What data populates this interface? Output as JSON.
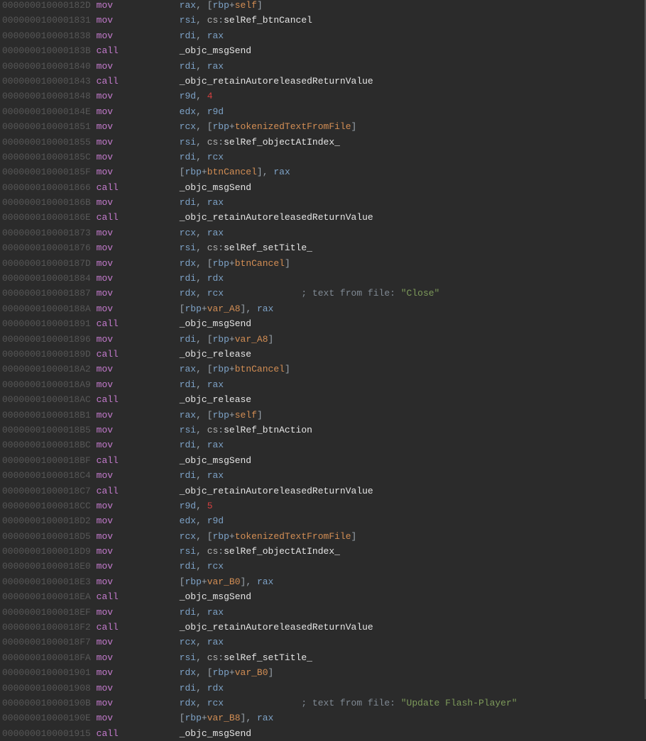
{
  "rows": [
    {
      "addr": "000000010000182D",
      "mn": "mov",
      "ops": [
        {
          "t": "reg",
          "v": "rax"
        },
        {
          "t": "punc",
          "v": ", "
        },
        {
          "t": "brkt",
          "v": "["
        },
        {
          "t": "reg",
          "v": "rbp"
        },
        {
          "t": "punc",
          "v": "+"
        },
        {
          "t": "kw",
          "v": "self"
        },
        {
          "t": "brkt",
          "v": "]"
        }
      ]
    },
    {
      "addr": "0000000100001831",
      "mn": "mov",
      "ops": [
        {
          "t": "reg",
          "v": "rsi"
        },
        {
          "t": "punc",
          "v": ", "
        },
        {
          "t": "seg",
          "v": "cs"
        },
        {
          "t": "punc",
          "v": ":"
        },
        {
          "t": "sym",
          "v": "selRef_btnCancel"
        }
      ]
    },
    {
      "addr": "0000000100001838",
      "mn": "mov",
      "ops": [
        {
          "t": "reg",
          "v": "rdi"
        },
        {
          "t": "punc",
          "v": ", "
        },
        {
          "t": "reg",
          "v": "rax"
        }
      ]
    },
    {
      "addr": "000000010000183B",
      "mn": "call",
      "ops": [
        {
          "t": "sym",
          "v": "_objc_msgSend"
        }
      ]
    },
    {
      "addr": "0000000100001840",
      "mn": "mov",
      "ops": [
        {
          "t": "reg",
          "v": "rdi"
        },
        {
          "t": "punc",
          "v": ", "
        },
        {
          "t": "reg",
          "v": "rax"
        }
      ]
    },
    {
      "addr": "0000000100001843",
      "mn": "call",
      "ops": [
        {
          "t": "sym",
          "v": "_objc_retainAutoreleasedReturnValue"
        }
      ]
    },
    {
      "addr": "0000000100001848",
      "mn": "mov",
      "ops": [
        {
          "t": "reg",
          "v": "r9d"
        },
        {
          "t": "punc",
          "v": ", "
        },
        {
          "t": "num",
          "v": "4"
        }
      ]
    },
    {
      "addr": "000000010000184E",
      "mn": "mov",
      "ops": [
        {
          "t": "reg",
          "v": "edx"
        },
        {
          "t": "punc",
          "v": ", "
        },
        {
          "t": "reg",
          "v": "r9d"
        }
      ]
    },
    {
      "addr": "0000000100001851",
      "mn": "mov",
      "ops": [
        {
          "t": "reg",
          "v": "rcx"
        },
        {
          "t": "punc",
          "v": ", "
        },
        {
          "t": "brkt",
          "v": "["
        },
        {
          "t": "reg",
          "v": "rbp"
        },
        {
          "t": "punc",
          "v": "+"
        },
        {
          "t": "kw",
          "v": "tokenizedTextFromFile"
        },
        {
          "t": "brkt",
          "v": "]"
        }
      ]
    },
    {
      "addr": "0000000100001855",
      "mn": "mov",
      "ops": [
        {
          "t": "reg",
          "v": "rsi"
        },
        {
          "t": "punc",
          "v": ", "
        },
        {
          "t": "seg",
          "v": "cs"
        },
        {
          "t": "punc",
          "v": ":"
        },
        {
          "t": "sym",
          "v": "selRef_objectAtIndex_"
        }
      ]
    },
    {
      "addr": "000000010000185C",
      "mn": "mov",
      "ops": [
        {
          "t": "reg",
          "v": "rdi"
        },
        {
          "t": "punc",
          "v": ", "
        },
        {
          "t": "reg",
          "v": "rcx"
        }
      ]
    },
    {
      "addr": "000000010000185F",
      "mn": "mov",
      "ops": [
        {
          "t": "brkt",
          "v": "["
        },
        {
          "t": "reg",
          "v": "rbp"
        },
        {
          "t": "punc",
          "v": "+"
        },
        {
          "t": "kw",
          "v": "btnCancel"
        },
        {
          "t": "brkt",
          "v": "]"
        },
        {
          "t": "punc",
          "v": ", "
        },
        {
          "t": "reg",
          "v": "rax"
        }
      ]
    },
    {
      "addr": "0000000100001866",
      "mn": "call",
      "ops": [
        {
          "t": "sym",
          "v": "_objc_msgSend"
        }
      ]
    },
    {
      "addr": "000000010000186B",
      "mn": "mov",
      "ops": [
        {
          "t": "reg",
          "v": "rdi"
        },
        {
          "t": "punc",
          "v": ", "
        },
        {
          "t": "reg",
          "v": "rax"
        }
      ]
    },
    {
      "addr": "000000010000186E",
      "mn": "call",
      "ops": [
        {
          "t": "sym",
          "v": "_objc_retainAutoreleasedReturnValue"
        }
      ]
    },
    {
      "addr": "0000000100001873",
      "mn": "mov",
      "ops": [
        {
          "t": "reg",
          "v": "rcx"
        },
        {
          "t": "punc",
          "v": ", "
        },
        {
          "t": "reg",
          "v": "rax"
        }
      ]
    },
    {
      "addr": "0000000100001876",
      "mn": "mov",
      "ops": [
        {
          "t": "reg",
          "v": "rsi"
        },
        {
          "t": "punc",
          "v": ", "
        },
        {
          "t": "seg",
          "v": "cs"
        },
        {
          "t": "punc",
          "v": ":"
        },
        {
          "t": "sym",
          "v": "selRef_setTitle_"
        }
      ]
    },
    {
      "addr": "000000010000187D",
      "mn": "mov",
      "ops": [
        {
          "t": "reg",
          "v": "rdx"
        },
        {
          "t": "punc",
          "v": ", "
        },
        {
          "t": "brkt",
          "v": "["
        },
        {
          "t": "reg",
          "v": "rbp"
        },
        {
          "t": "punc",
          "v": "+"
        },
        {
          "t": "kw",
          "v": "btnCancel"
        },
        {
          "t": "brkt",
          "v": "]"
        }
      ]
    },
    {
      "addr": "0000000100001884",
      "mn": "mov",
      "ops": [
        {
          "t": "reg",
          "v": "rdi"
        },
        {
          "t": "punc",
          "v": ", "
        },
        {
          "t": "reg",
          "v": "rdx"
        }
      ]
    },
    {
      "addr": "0000000100001887",
      "mn": "mov",
      "ops": [
        {
          "t": "reg",
          "v": "rdx"
        },
        {
          "t": "punc",
          "v": ", "
        },
        {
          "t": "reg",
          "v": "rcx"
        }
      ],
      "cmt": "; text from file: \"Close\""
    },
    {
      "addr": "000000010000188A",
      "mn": "mov",
      "ops": [
        {
          "t": "brkt",
          "v": "["
        },
        {
          "t": "reg",
          "v": "rbp"
        },
        {
          "t": "punc",
          "v": "+"
        },
        {
          "t": "kw",
          "v": "var_A8"
        },
        {
          "t": "brkt",
          "v": "]"
        },
        {
          "t": "punc",
          "v": ", "
        },
        {
          "t": "reg",
          "v": "rax"
        }
      ]
    },
    {
      "addr": "0000000100001891",
      "mn": "call",
      "ops": [
        {
          "t": "sym",
          "v": "_objc_msgSend"
        }
      ]
    },
    {
      "addr": "0000000100001896",
      "mn": "mov",
      "ops": [
        {
          "t": "reg",
          "v": "rdi"
        },
        {
          "t": "punc",
          "v": ", "
        },
        {
          "t": "brkt",
          "v": "["
        },
        {
          "t": "reg",
          "v": "rbp"
        },
        {
          "t": "punc",
          "v": "+"
        },
        {
          "t": "kw",
          "v": "var_A8"
        },
        {
          "t": "brkt",
          "v": "]"
        }
      ]
    },
    {
      "addr": "000000010000189D",
      "mn": "call",
      "ops": [
        {
          "t": "sym",
          "v": "_objc_release"
        }
      ]
    },
    {
      "addr": "00000001000018A2",
      "mn": "mov",
      "ops": [
        {
          "t": "reg",
          "v": "rax"
        },
        {
          "t": "punc",
          "v": ", "
        },
        {
          "t": "brkt",
          "v": "["
        },
        {
          "t": "reg",
          "v": "rbp"
        },
        {
          "t": "punc",
          "v": "+"
        },
        {
          "t": "kw",
          "v": "btnCancel"
        },
        {
          "t": "brkt",
          "v": "]"
        }
      ]
    },
    {
      "addr": "00000001000018A9",
      "mn": "mov",
      "ops": [
        {
          "t": "reg",
          "v": "rdi"
        },
        {
          "t": "punc",
          "v": ", "
        },
        {
          "t": "reg",
          "v": "rax"
        }
      ]
    },
    {
      "addr": "00000001000018AC",
      "mn": "call",
      "ops": [
        {
          "t": "sym",
          "v": "_objc_release"
        }
      ]
    },
    {
      "addr": "00000001000018B1",
      "mn": "mov",
      "ops": [
        {
          "t": "reg",
          "v": "rax"
        },
        {
          "t": "punc",
          "v": ", "
        },
        {
          "t": "brkt",
          "v": "["
        },
        {
          "t": "reg",
          "v": "rbp"
        },
        {
          "t": "punc",
          "v": "+"
        },
        {
          "t": "kw",
          "v": "self"
        },
        {
          "t": "brkt",
          "v": "]"
        }
      ]
    },
    {
      "addr": "00000001000018B5",
      "mn": "mov",
      "ops": [
        {
          "t": "reg",
          "v": "rsi"
        },
        {
          "t": "punc",
          "v": ", "
        },
        {
          "t": "seg",
          "v": "cs"
        },
        {
          "t": "punc",
          "v": ":"
        },
        {
          "t": "sym",
          "v": "selRef_btnAction"
        }
      ]
    },
    {
      "addr": "00000001000018BC",
      "mn": "mov",
      "ops": [
        {
          "t": "reg",
          "v": "rdi"
        },
        {
          "t": "punc",
          "v": ", "
        },
        {
          "t": "reg",
          "v": "rax"
        }
      ]
    },
    {
      "addr": "00000001000018BF",
      "mn": "call",
      "ops": [
        {
          "t": "sym",
          "v": "_objc_msgSend"
        }
      ]
    },
    {
      "addr": "00000001000018C4",
      "mn": "mov",
      "ops": [
        {
          "t": "reg",
          "v": "rdi"
        },
        {
          "t": "punc",
          "v": ", "
        },
        {
          "t": "reg",
          "v": "rax"
        }
      ]
    },
    {
      "addr": "00000001000018C7",
      "mn": "call",
      "ops": [
        {
          "t": "sym",
          "v": "_objc_retainAutoreleasedReturnValue"
        }
      ]
    },
    {
      "addr": "00000001000018CC",
      "mn": "mov",
      "ops": [
        {
          "t": "reg",
          "v": "r9d"
        },
        {
          "t": "punc",
          "v": ", "
        },
        {
          "t": "num",
          "v": "5"
        }
      ]
    },
    {
      "addr": "00000001000018D2",
      "mn": "mov",
      "ops": [
        {
          "t": "reg",
          "v": "edx"
        },
        {
          "t": "punc",
          "v": ", "
        },
        {
          "t": "reg",
          "v": "r9d"
        }
      ]
    },
    {
      "addr": "00000001000018D5",
      "mn": "mov",
      "ops": [
        {
          "t": "reg",
          "v": "rcx"
        },
        {
          "t": "punc",
          "v": ", "
        },
        {
          "t": "brkt",
          "v": "["
        },
        {
          "t": "reg",
          "v": "rbp"
        },
        {
          "t": "punc",
          "v": "+"
        },
        {
          "t": "kw",
          "v": "tokenizedTextFromFile"
        },
        {
          "t": "brkt",
          "v": "]"
        }
      ]
    },
    {
      "addr": "00000001000018D9",
      "mn": "mov",
      "ops": [
        {
          "t": "reg",
          "v": "rsi"
        },
        {
          "t": "punc",
          "v": ", "
        },
        {
          "t": "seg",
          "v": "cs"
        },
        {
          "t": "punc",
          "v": ":"
        },
        {
          "t": "sym",
          "v": "selRef_objectAtIndex_"
        }
      ]
    },
    {
      "addr": "00000001000018E0",
      "mn": "mov",
      "ops": [
        {
          "t": "reg",
          "v": "rdi"
        },
        {
          "t": "punc",
          "v": ", "
        },
        {
          "t": "reg",
          "v": "rcx"
        }
      ]
    },
    {
      "addr": "00000001000018E3",
      "mn": "mov",
      "ops": [
        {
          "t": "brkt",
          "v": "["
        },
        {
          "t": "reg",
          "v": "rbp"
        },
        {
          "t": "punc",
          "v": "+"
        },
        {
          "t": "kw",
          "v": "var_B0"
        },
        {
          "t": "brkt",
          "v": "]"
        },
        {
          "t": "punc",
          "v": ", "
        },
        {
          "t": "reg",
          "v": "rax"
        }
      ]
    },
    {
      "addr": "00000001000018EA",
      "mn": "call",
      "ops": [
        {
          "t": "sym",
          "v": "_objc_msgSend"
        }
      ]
    },
    {
      "addr": "00000001000018EF",
      "mn": "mov",
      "ops": [
        {
          "t": "reg",
          "v": "rdi"
        },
        {
          "t": "punc",
          "v": ", "
        },
        {
          "t": "reg",
          "v": "rax"
        }
      ]
    },
    {
      "addr": "00000001000018F2",
      "mn": "call",
      "ops": [
        {
          "t": "sym",
          "v": "_objc_retainAutoreleasedReturnValue"
        }
      ]
    },
    {
      "addr": "00000001000018F7",
      "mn": "mov",
      "ops": [
        {
          "t": "reg",
          "v": "rcx"
        },
        {
          "t": "punc",
          "v": ", "
        },
        {
          "t": "reg",
          "v": "rax"
        }
      ]
    },
    {
      "addr": "00000001000018FA",
      "mn": "mov",
      "ops": [
        {
          "t": "reg",
          "v": "rsi"
        },
        {
          "t": "punc",
          "v": ", "
        },
        {
          "t": "seg",
          "v": "cs"
        },
        {
          "t": "punc",
          "v": ":"
        },
        {
          "t": "sym",
          "v": "selRef_setTitle_"
        }
      ]
    },
    {
      "addr": "0000000100001901",
      "mn": "mov",
      "ops": [
        {
          "t": "reg",
          "v": "rdx"
        },
        {
          "t": "punc",
          "v": ", "
        },
        {
          "t": "brkt",
          "v": "["
        },
        {
          "t": "reg",
          "v": "rbp"
        },
        {
          "t": "punc",
          "v": "+"
        },
        {
          "t": "kw",
          "v": "var_B0"
        },
        {
          "t": "brkt",
          "v": "]"
        }
      ]
    },
    {
      "addr": "0000000100001908",
      "mn": "mov",
      "ops": [
        {
          "t": "reg",
          "v": "rdi"
        },
        {
          "t": "punc",
          "v": ", "
        },
        {
          "t": "reg",
          "v": "rdx"
        }
      ]
    },
    {
      "addr": "000000010000190B",
      "mn": "mov",
      "ops": [
        {
          "t": "reg",
          "v": "rdx"
        },
        {
          "t": "punc",
          "v": ", "
        },
        {
          "t": "reg",
          "v": "rcx"
        }
      ],
      "cmt": "; text from file: \"Update Flash-Player\""
    },
    {
      "addr": "000000010000190E",
      "mn": "mov",
      "ops": [
        {
          "t": "brkt",
          "v": "["
        },
        {
          "t": "reg",
          "v": "rbp"
        },
        {
          "t": "punc",
          "v": "+"
        },
        {
          "t": "kw",
          "v": "var_B8"
        },
        {
          "t": "brkt",
          "v": "]"
        },
        {
          "t": "punc",
          "v": ", "
        },
        {
          "t": "reg",
          "v": "rax"
        }
      ]
    },
    {
      "addr": "0000000100001915",
      "mn": "call",
      "ops": [
        {
          "t": "sym",
          "v": "_objc_msgSend"
        }
      ]
    }
  ],
  "col_addr_w": 17,
  "col_mn_w": 8,
  "col_ops_start": 32,
  "cmt_col": 54
}
